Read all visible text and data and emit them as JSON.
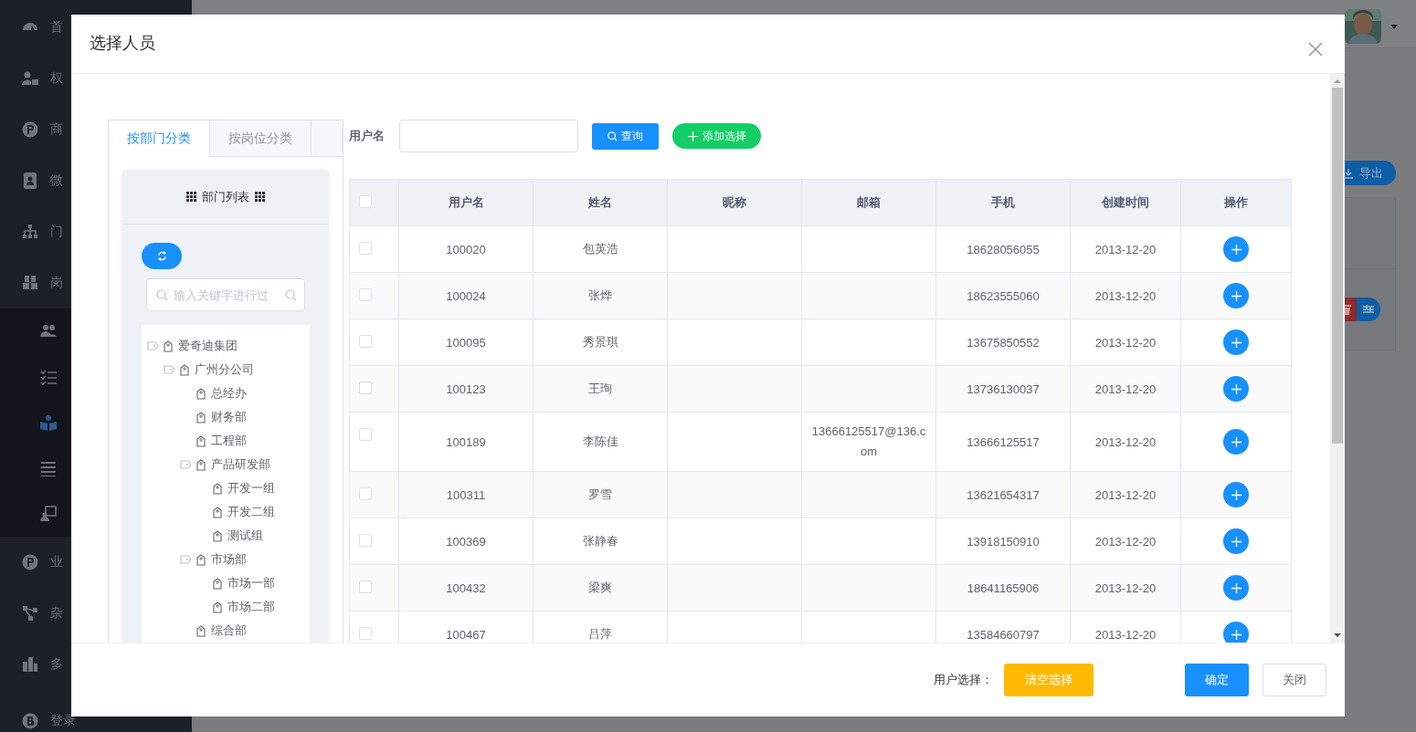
{
  "sidebar": {
    "items": [
      {
        "kind": "main",
        "label": "首"
      },
      {
        "kind": "main",
        "label": "权"
      },
      {
        "kind": "main",
        "label": "商"
      },
      {
        "kind": "main",
        "label": "微"
      },
      {
        "kind": "main",
        "label": "门"
      },
      {
        "kind": "main",
        "label": "岗"
      },
      {
        "kind": "sub",
        "selected": false
      },
      {
        "kind": "sub",
        "selected": false
      },
      {
        "kind": "sub",
        "selected": true
      },
      {
        "kind": "sub",
        "selected": false
      },
      {
        "kind": "sub",
        "selected": false
      },
      {
        "kind": "main",
        "label": "业"
      },
      {
        "kind": "main",
        "label": "杂"
      },
      {
        "kind": "main",
        "label": "多"
      },
      {
        "kind": "main",
        "label": "登录"
      }
    ]
  },
  "page": {
    "export_button": "导出"
  },
  "dialog": {
    "title": "选择人员",
    "tabs": [
      {
        "label": "按部门分类",
        "selected": true
      },
      {
        "label": "按岗位分类",
        "selected": false
      }
    ],
    "department_panel": {
      "title": "部门列表",
      "search": {
        "placeholder": "输入关键字进行过"
      },
      "tree": [
        {
          "label": "爱奇迪集团",
          "expanded": true,
          "children": [
            {
              "label": "广州分公司",
              "expanded": true,
              "children": [
                {
                  "label": "总经办"
                },
                {
                  "label": "财务部"
                },
                {
                  "label": "工程部"
                },
                {
                  "label": "产品研发部",
                  "expanded": true,
                  "children": [
                    {
                      "label": "开发一组"
                    },
                    {
                      "label": "开发二组"
                    },
                    {
                      "label": "测试组"
                    }
                  ]
                },
                {
                  "label": "市场部",
                  "expanded": true,
                  "children": [
                    {
                      "label": "市场一部"
                    },
                    {
                      "label": "市场二部"
                    }
                  ]
                },
                {
                  "label": "综合部"
                }
              ]
            }
          ]
        }
      ]
    },
    "filter": {
      "label": "用户名",
      "query_button": "查询",
      "add_button": "添加选择"
    },
    "table": {
      "all_checked": false,
      "columns": [
        "用户名",
        "姓名",
        "昵称",
        "邮箱",
        "手机",
        "创建时间",
        "操作"
      ],
      "rows": [
        {
          "checked": false,
          "cells": [
            "100020",
            "包英浩",
            "",
            "",
            "18628056055",
            "2013-12-20"
          ]
        },
        {
          "checked": false,
          "cells": [
            "100024",
            "张烨",
            "",
            "",
            "18623555060",
            "2013-12-20"
          ]
        },
        {
          "checked": false,
          "cells": [
            "100095",
            "秀景琪",
            "",
            "",
            "13675850552",
            "2013-12-20"
          ]
        },
        {
          "checked": false,
          "cells": [
            "100123",
            "王珣",
            "",
            "",
            "13736130037",
            "2013-12-20"
          ]
        },
        {
          "checked": false,
          "cells": [
            "100189",
            "李陈佳",
            "",
            "13666125517@136.com",
            "13666125517",
            "2013-12-20"
          ]
        },
        {
          "checked": false,
          "cells": [
            "100311",
            "罗雪",
            "",
            "",
            "13621654317",
            "2013-12-20"
          ]
        },
        {
          "checked": false,
          "cells": [
            "100369",
            "张静春",
            "",
            "",
            "13918150910",
            "2013-12-20"
          ]
        },
        {
          "checked": false,
          "cells": [
            "100432",
            "梁爽",
            "",
            "",
            "18641165906",
            "2013-12-20"
          ]
        },
        {
          "checked": false,
          "cells": [
            "100467",
            "吕萍",
            "",
            "",
            "13584660797",
            "2013-12-20"
          ]
        }
      ]
    },
    "footer": {
      "label": "用户选择：",
      "clear_button": "清空选择",
      "confirm_button": "确定",
      "close_button": "关闭"
    }
  }
}
